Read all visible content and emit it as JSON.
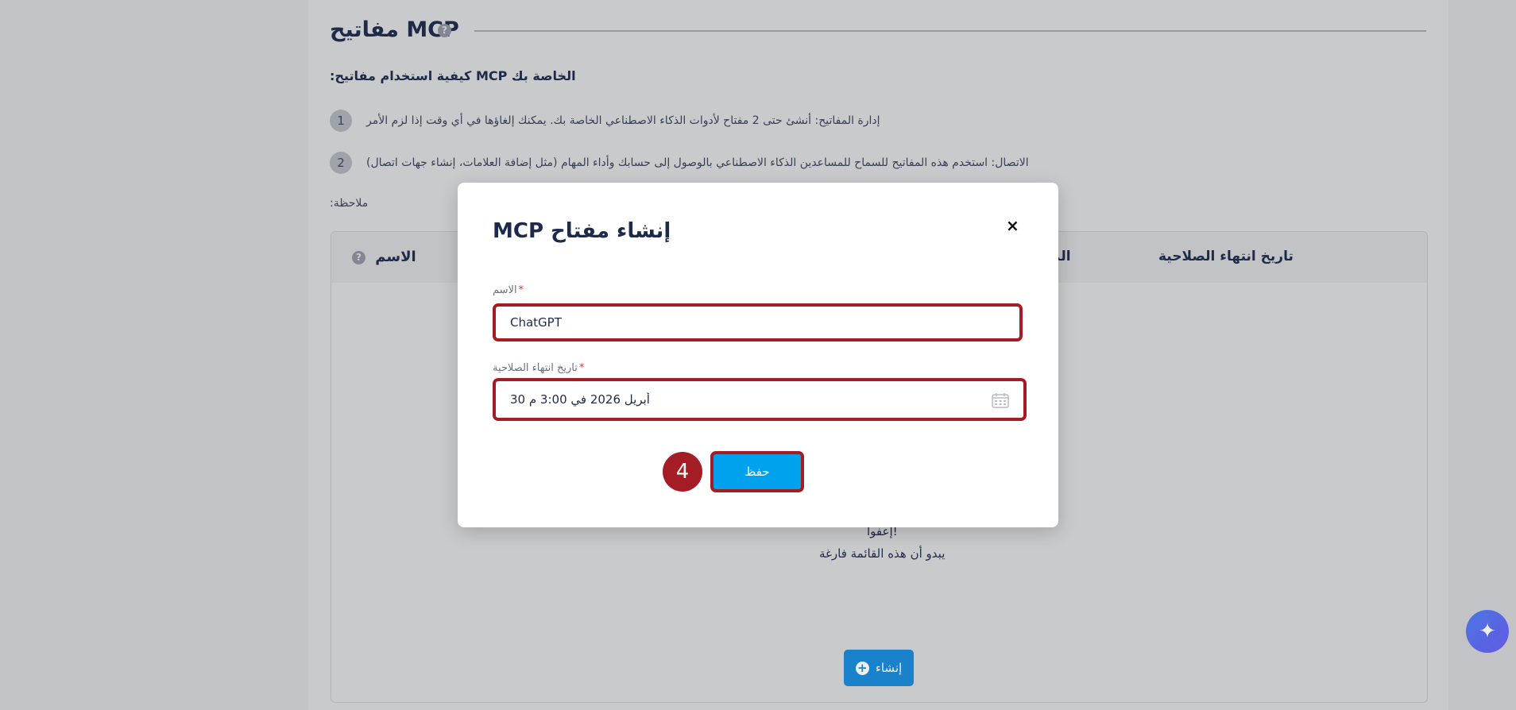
{
  "section": {
    "title": "MCP مفاتيح",
    "help": "?",
    "subtitle": "الخاصة بك MCP كيفية استخدام مفاتيح:",
    "steps": [
      {
        "num": "1",
        "text": "إدارة المفاتيح: أنشئ حتى 2 مفتاح لأدوات الذكاء الاصطناعي الخاصة بك. يمكنك إلغاؤها في أي وقت إذا لزم الأمر"
      },
      {
        "num": "2",
        "text": "الاتصال: استخدم هذه المفاتيح للسماح للمساعدين الذكاء الاصطناعي بالوصول إلى حسابك وأداء المهام (مثل إضافة العلامات، إنشاء جهات اتصال)"
      }
    ],
    "note": "ملاحظة:"
  },
  "table": {
    "col_name": "الاسم",
    "col_mid": "الم",
    "col_expiry": "تاريخ انتهاء الصلاحية",
    "empty_title": "إعفوا!",
    "empty_text": "يبدو أن هذه القائمة فارغة",
    "create_label": "إنشاء",
    "create_icon": "+"
  },
  "fab": {
    "icon": "✦"
  },
  "modal": {
    "title": "إنشاء مفتاح MCP",
    "close": "×",
    "name_label": "الاسم",
    "name_value": "ChatGPT",
    "expiry_label": "تاريخ انتهاء الصلاحية",
    "expiry_value": "30 أبريل 2026 في 3:00 م",
    "required_mark": "*",
    "save_label": "حفظ",
    "step_badge": "4"
  },
  "colors": {
    "accent": "#00a2ee",
    "highlight": "#a51d24",
    "text": "#1e2a4a"
  }
}
